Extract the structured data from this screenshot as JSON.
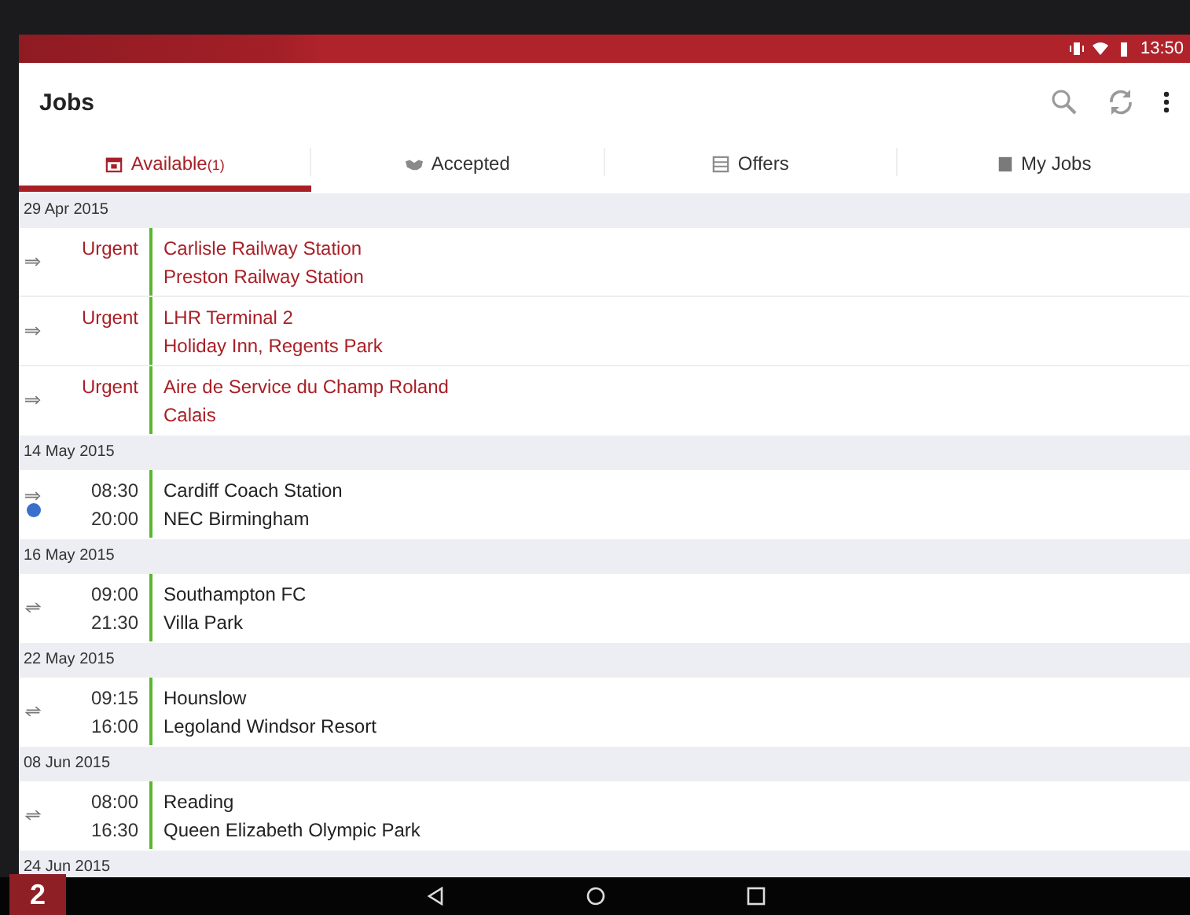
{
  "status_bar": {
    "time": "13:50"
  },
  "app_bar": {
    "title": "Jobs"
  },
  "tabs": [
    {
      "label": "Available",
      "count": "(1)",
      "selected": true
    },
    {
      "label": "Accepted",
      "selected": false
    },
    {
      "label": "Offers",
      "selected": false
    },
    {
      "label": "My Jobs",
      "selected": false
    }
  ],
  "groups": [
    {
      "date": "29 Apr 2015",
      "jobs": [
        {
          "kind": "one_way",
          "urgent": true,
          "flagged": false,
          "times": [
            "Urgent"
          ],
          "from": "Carlisle Railway Station",
          "to": "Preston Railway Station"
        },
        {
          "kind": "one_way",
          "urgent": true,
          "flagged": false,
          "times": [
            "Urgent"
          ],
          "from": "LHR Terminal 2",
          "to": "Holiday Inn, Regents Park"
        },
        {
          "kind": "one_way",
          "urgent": true,
          "flagged": false,
          "times": [
            "Urgent"
          ],
          "from": "Aire de Service du Champ Roland",
          "to": "Calais"
        }
      ]
    },
    {
      "date": "14 May 2015",
      "jobs": [
        {
          "kind": "one_way",
          "urgent": false,
          "flagged": true,
          "times": [
            "08:30",
            "20:00"
          ],
          "from": "Cardiff Coach Station",
          "to": "NEC Birmingham"
        }
      ]
    },
    {
      "date": "16 May 2015",
      "jobs": [
        {
          "kind": "return",
          "urgent": false,
          "flagged": false,
          "times": [
            "09:00",
            "21:30"
          ],
          "from": "Southampton FC",
          "to": "Villa Park"
        }
      ]
    },
    {
      "date": "22 May 2015",
      "jobs": [
        {
          "kind": "return",
          "urgent": false,
          "flagged": false,
          "times": [
            "09:15",
            "16:00"
          ],
          "from": "Hounslow",
          "to": "Legoland Windsor Resort"
        }
      ]
    },
    {
      "date": "08 Jun 2015",
      "jobs": [
        {
          "kind": "return",
          "urgent": false,
          "flagged": false,
          "times": [
            "08:00",
            "16:30"
          ],
          "from": "Reading",
          "to": "Queen Elizabeth Olympic Park"
        }
      ]
    },
    {
      "date": "24 Jun 2015"
    }
  ],
  "figure_number": "2"
}
